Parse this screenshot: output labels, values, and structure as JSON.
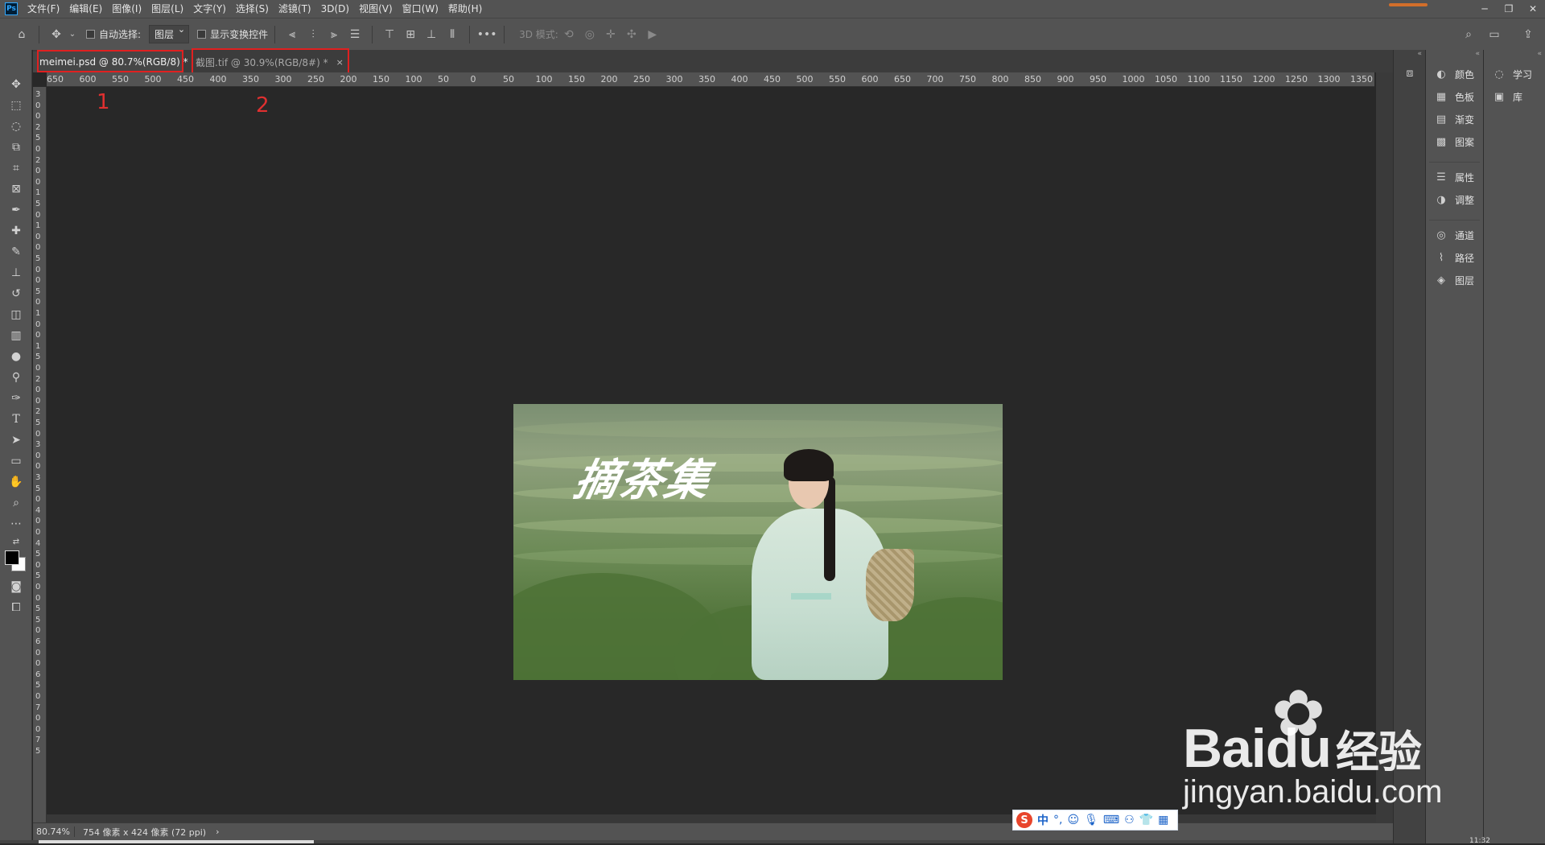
{
  "app": {
    "logo": "Ps",
    "menus": [
      "文件(F)",
      "编辑(E)",
      "图像(I)",
      "图层(L)",
      "文字(Y)",
      "选择(S)",
      "滤镜(T)",
      "3D(D)",
      "视图(V)",
      "窗口(W)",
      "帮助(H)"
    ],
    "window_controls": [
      "─",
      "❐",
      "✕"
    ]
  },
  "options": {
    "auto_select_label": "自动选择:",
    "layer_select_value": "图层",
    "show_transform_label": "显示变换控件",
    "mode_3d_label": "3D 模式:",
    "more": "•••"
  },
  "tabs": [
    {
      "label": "meimei.psd @ 80.7%(RGB/8) *",
      "close": "×",
      "active": true
    },
    {
      "label": "截图.tif @ 30.9%(RGB/8#) *",
      "close": "×",
      "active": false
    }
  ],
  "annotations": [
    "1",
    "2"
  ],
  "ruler_ticks": [
    "650",
    "600",
    "550",
    "500",
    "450",
    "400",
    "350",
    "300",
    "250",
    "200",
    "150",
    "100",
    "50",
    "0",
    "50",
    "100",
    "150",
    "200",
    "250",
    "300",
    "350",
    "400",
    "450",
    "500",
    "550",
    "600",
    "650",
    "700",
    "750",
    "800",
    "850",
    "900",
    "950",
    "1000",
    "1050",
    "1100",
    "1150",
    "1200",
    "1250",
    "1300",
    "1350"
  ],
  "image": {
    "calligraphy": "摘茶集"
  },
  "status": {
    "zoom": "80.74%",
    "doc_info": "754 像素 x 424 像素 (72 ppi)",
    "arrow": "›"
  },
  "panels": {
    "group1": [
      {
        "icon": "palette-icon",
        "glyph": "◐",
        "label": "颜色"
      },
      {
        "icon": "swatches-icon",
        "glyph": "▦",
        "label": "色板"
      },
      {
        "icon": "gradient-icon",
        "glyph": "▤",
        "label": "渐变"
      },
      {
        "icon": "pattern-icon",
        "glyph": "▩",
        "label": "图案"
      }
    ],
    "group2": [
      {
        "icon": "properties-icon",
        "glyph": "☰",
        "label": "属性"
      },
      {
        "icon": "adjustments-icon",
        "glyph": "◑",
        "label": "调整"
      }
    ],
    "group3": [
      {
        "icon": "channels-icon",
        "glyph": "◎",
        "label": "通道"
      },
      {
        "icon": "paths-icon",
        "glyph": "⌇",
        "label": "路径"
      },
      {
        "icon": "layers-icon",
        "glyph": "◈",
        "label": "图层"
      }
    ],
    "right": [
      {
        "icon": "learn-icon",
        "glyph": "💡",
        "label": "学习"
      },
      {
        "icon": "libraries-icon",
        "glyph": "▣",
        "label": "库"
      }
    ]
  },
  "ime": {
    "logo": "S",
    "mode": "中"
  },
  "watermark": {
    "brand": "Bai",
    "brand2": "du",
    "brand_cn": "经验",
    "url": "jingyan.baidu.com"
  },
  "clock": "11:32"
}
